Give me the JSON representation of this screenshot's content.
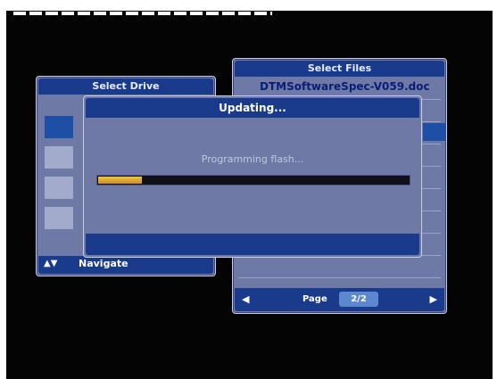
{
  "files_panel": {
    "title": "Select Files",
    "first_file": "DTMSoftwareSpec-V059.doc",
    "page_label": "Page",
    "page_value": "2/2",
    "prev_icon": "arrow-left-icon",
    "next_icon": "arrow-right-icon"
  },
  "drive_panel": {
    "title": "Select Drive",
    "nav_label": "Navigate",
    "nav_icon": "up-down-arrows-icon"
  },
  "dialog": {
    "title": "Updating...",
    "message": "Programming flash...",
    "progress": 0.14
  },
  "colors": {
    "panel_bg": "#6e79a6",
    "header_bg": "#1a3b8c",
    "highlight": "#1e4fa6",
    "progress_fill": "#e0a52a"
  }
}
